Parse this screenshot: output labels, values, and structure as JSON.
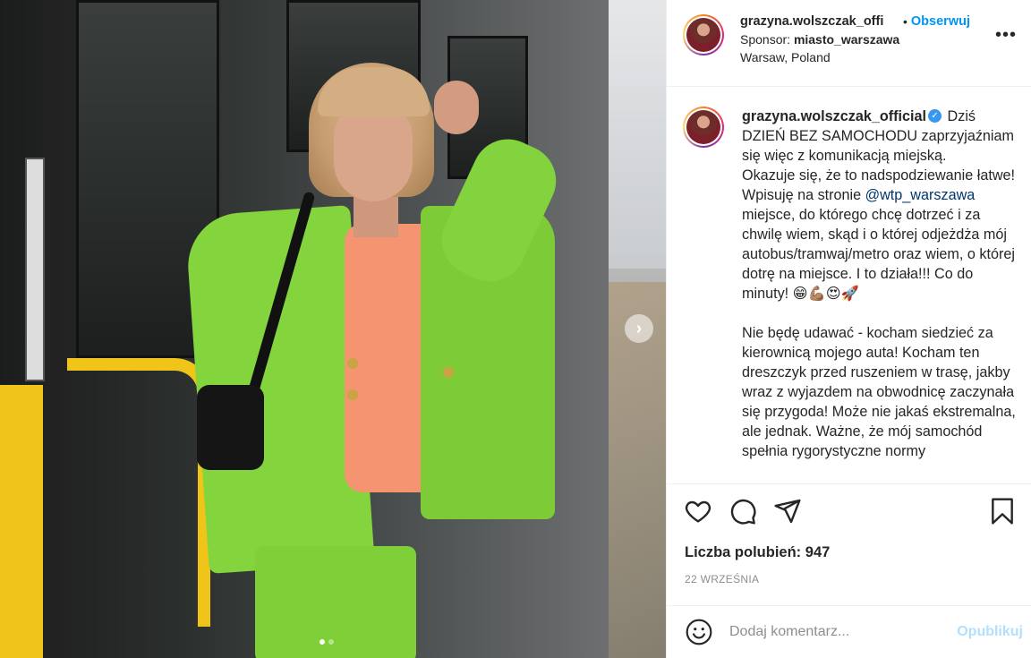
{
  "header": {
    "username": "grazyna.wolszczak_offi",
    "separator": "•",
    "follow_label": "Obserwuj",
    "sponsor_prefix": "Sponsor:",
    "sponsor_name": "miasto_warszawa",
    "location": "Warsaw, Poland",
    "more_label": "•••"
  },
  "caption": {
    "username": "grazyna.wolszczak_official",
    "verified_glyph": "✓",
    "part1": "Dziś DZIEŃ BEZ SAMOCHODU zaprzyjaźniam się więc z komunikacją miejską.",
    "part2": "Okazuje się, że to nadspodziewanie łatwe! Wpisuję na stronie",
    "mention": "@wtp_warszawa",
    "part3": "miejsce, do którego chcę dotrzeć i za chwilę wiem, skąd i o której odjeżdża mój autobus/tramwaj/metro oraz wiem, o której dotrę na miejsce. I to działa!!! Co do minuty! 😁💪🏽😍🚀",
    "paragraph2": "Nie będę udawać - kocham siedzieć za kierownicą mojego auta! Kocham ten dreszczyk przed ruszeniem w trasę, jakby wraz z wyjazdem na obwodnicę zaczynała się przygoda! Może nie jakaś ekstremalna, ale jednak. Ważne, że mój samochód spełnia rygorystyczne normy"
  },
  "media": {
    "next_glyph": "›",
    "dots_count": 2,
    "active_dot": 0
  },
  "actions": {
    "like_icon": "heart-icon",
    "comment_icon": "comment-icon",
    "share_icon": "share-icon",
    "save_icon": "bookmark-icon"
  },
  "likes": {
    "label": "Liczba polubień:",
    "count": "947"
  },
  "date": "22 WRZEŚNIA",
  "comment": {
    "placeholder": "Dodaj komentarz...",
    "publish_label": "Opublikuj"
  },
  "colors": {
    "link_blue": "#0095f6",
    "publish_disabled": "#b2dffc",
    "mention": "#00376b",
    "blazer_green": "#84d43e"
  }
}
